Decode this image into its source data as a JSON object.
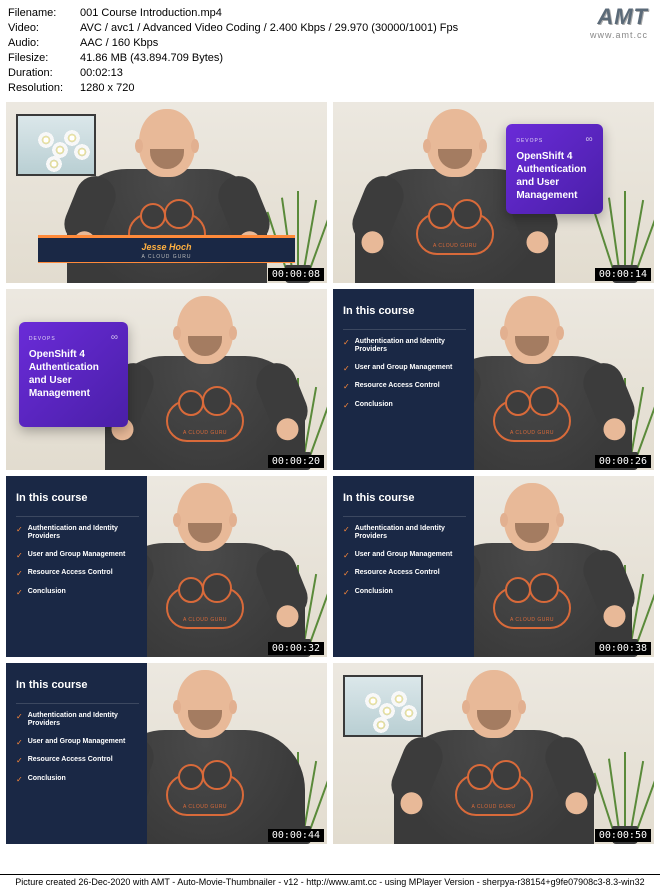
{
  "logo": {
    "main": "AMT",
    "sub": "www.amt.cc"
  },
  "meta": {
    "filename_label": "Filename:",
    "filename": "001 Course Introduction.mp4",
    "video_label": "Video:",
    "video": "AVC / avc1 / Advanced Video Coding / 2.400 Kbps / 29.970 (30000/1001) Fps",
    "audio_label": "Audio:",
    "audio": "AAC / 160 Kbps",
    "filesize_label": "Filesize:",
    "filesize": "41.86 MB (43.894.709 Bytes)",
    "duration_label": "Duration:",
    "duration": "00:02:13",
    "resolution_label": "Resolution:",
    "resolution": "1280 x 720"
  },
  "slide": {
    "devops": "DEVOPS",
    "title": "OpenShift 4 Authentication and User Management",
    "course_heading": "In this course",
    "bullets": [
      "Authentication and Identity Providers",
      "User and Group Management",
      "Resource Access Control",
      "Conclusion"
    ]
  },
  "shirt": {
    "text": "A CLOUD GURU"
  },
  "lower_third": {
    "name": "Jesse Hoch",
    "sub": "A CLOUD GURU"
  },
  "timestamps": [
    "00:00:08",
    "00:00:14",
    "00:00:20",
    "00:00:26",
    "00:00:32",
    "00:00:38",
    "00:00:44",
    "00:00:50"
  ],
  "footer": "Picture created 26-Dec-2020 with AMT - Auto-Movie-Thumbnailer - v12 - http://www.amt.cc - using MPlayer Version - sherpya-r38154+g9fe07908c3-8.3-win32"
}
